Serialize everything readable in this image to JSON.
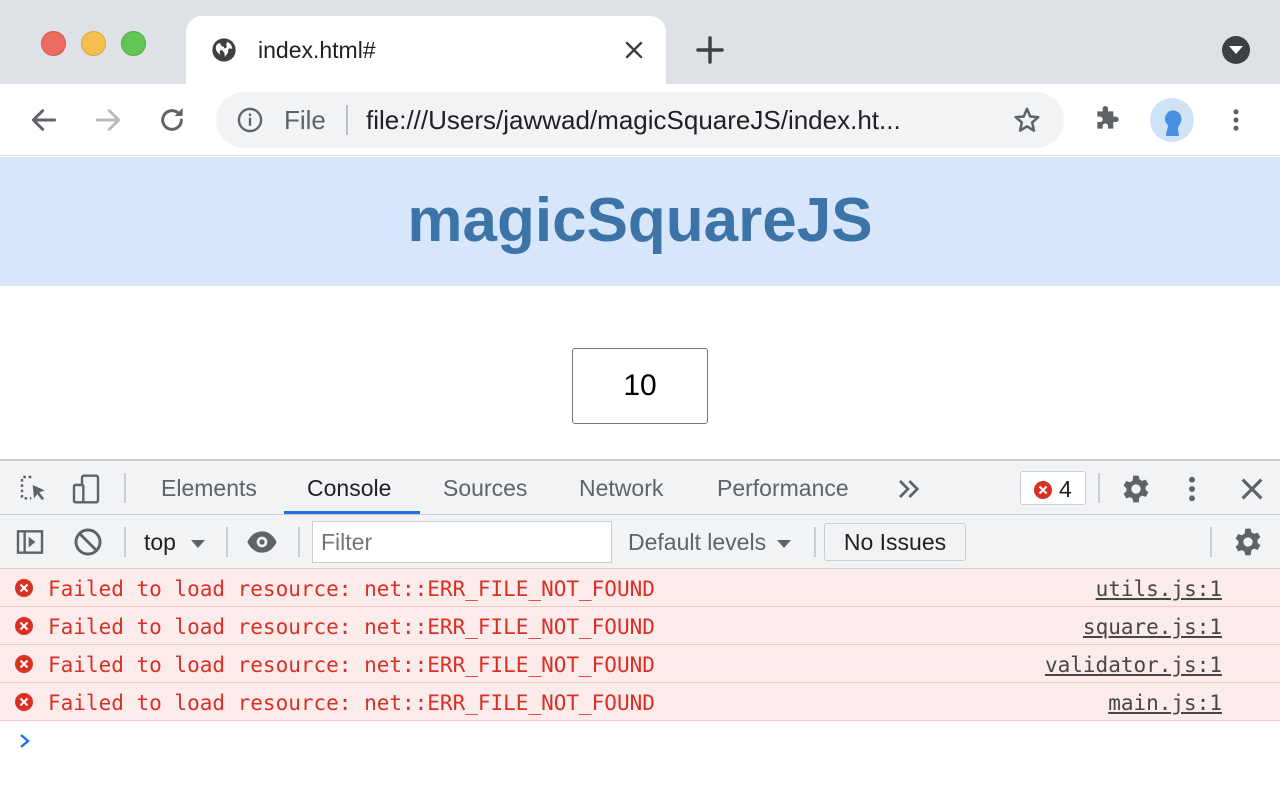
{
  "browser": {
    "tab_title": "index.html#",
    "omnibox": {
      "scheme_label": "File",
      "url": "file:///Users/jawwad/magicSquareJS/index.ht..."
    }
  },
  "page": {
    "title": "magicSquareJS",
    "input_value": "10"
  },
  "devtools": {
    "tabs": [
      "Elements",
      "Console",
      "Sources",
      "Network",
      "Performance"
    ],
    "active_tab": "Console",
    "error_count": "4",
    "context": "top",
    "filter_placeholder": "Filter",
    "levels_label": "Default levels",
    "issues_label": "No Issues",
    "messages": [
      {
        "text": "Failed to load resource: net::ERR_FILE_NOT_FOUND",
        "source": "utils.js:1"
      },
      {
        "text": "Failed to load resource: net::ERR_FILE_NOT_FOUND",
        "source": "square.js:1"
      },
      {
        "text": "Failed to load resource: net::ERR_FILE_NOT_FOUND",
        "source": "validator.js:1"
      },
      {
        "text": "Failed to load resource: net::ERR_FILE_NOT_FOUND",
        "source": "main.js:1"
      }
    ]
  },
  "colors": {
    "banner": "#d8e6fb",
    "title": "#3c74a8",
    "error_text": "#d93025",
    "accent": "#1a73e8"
  }
}
